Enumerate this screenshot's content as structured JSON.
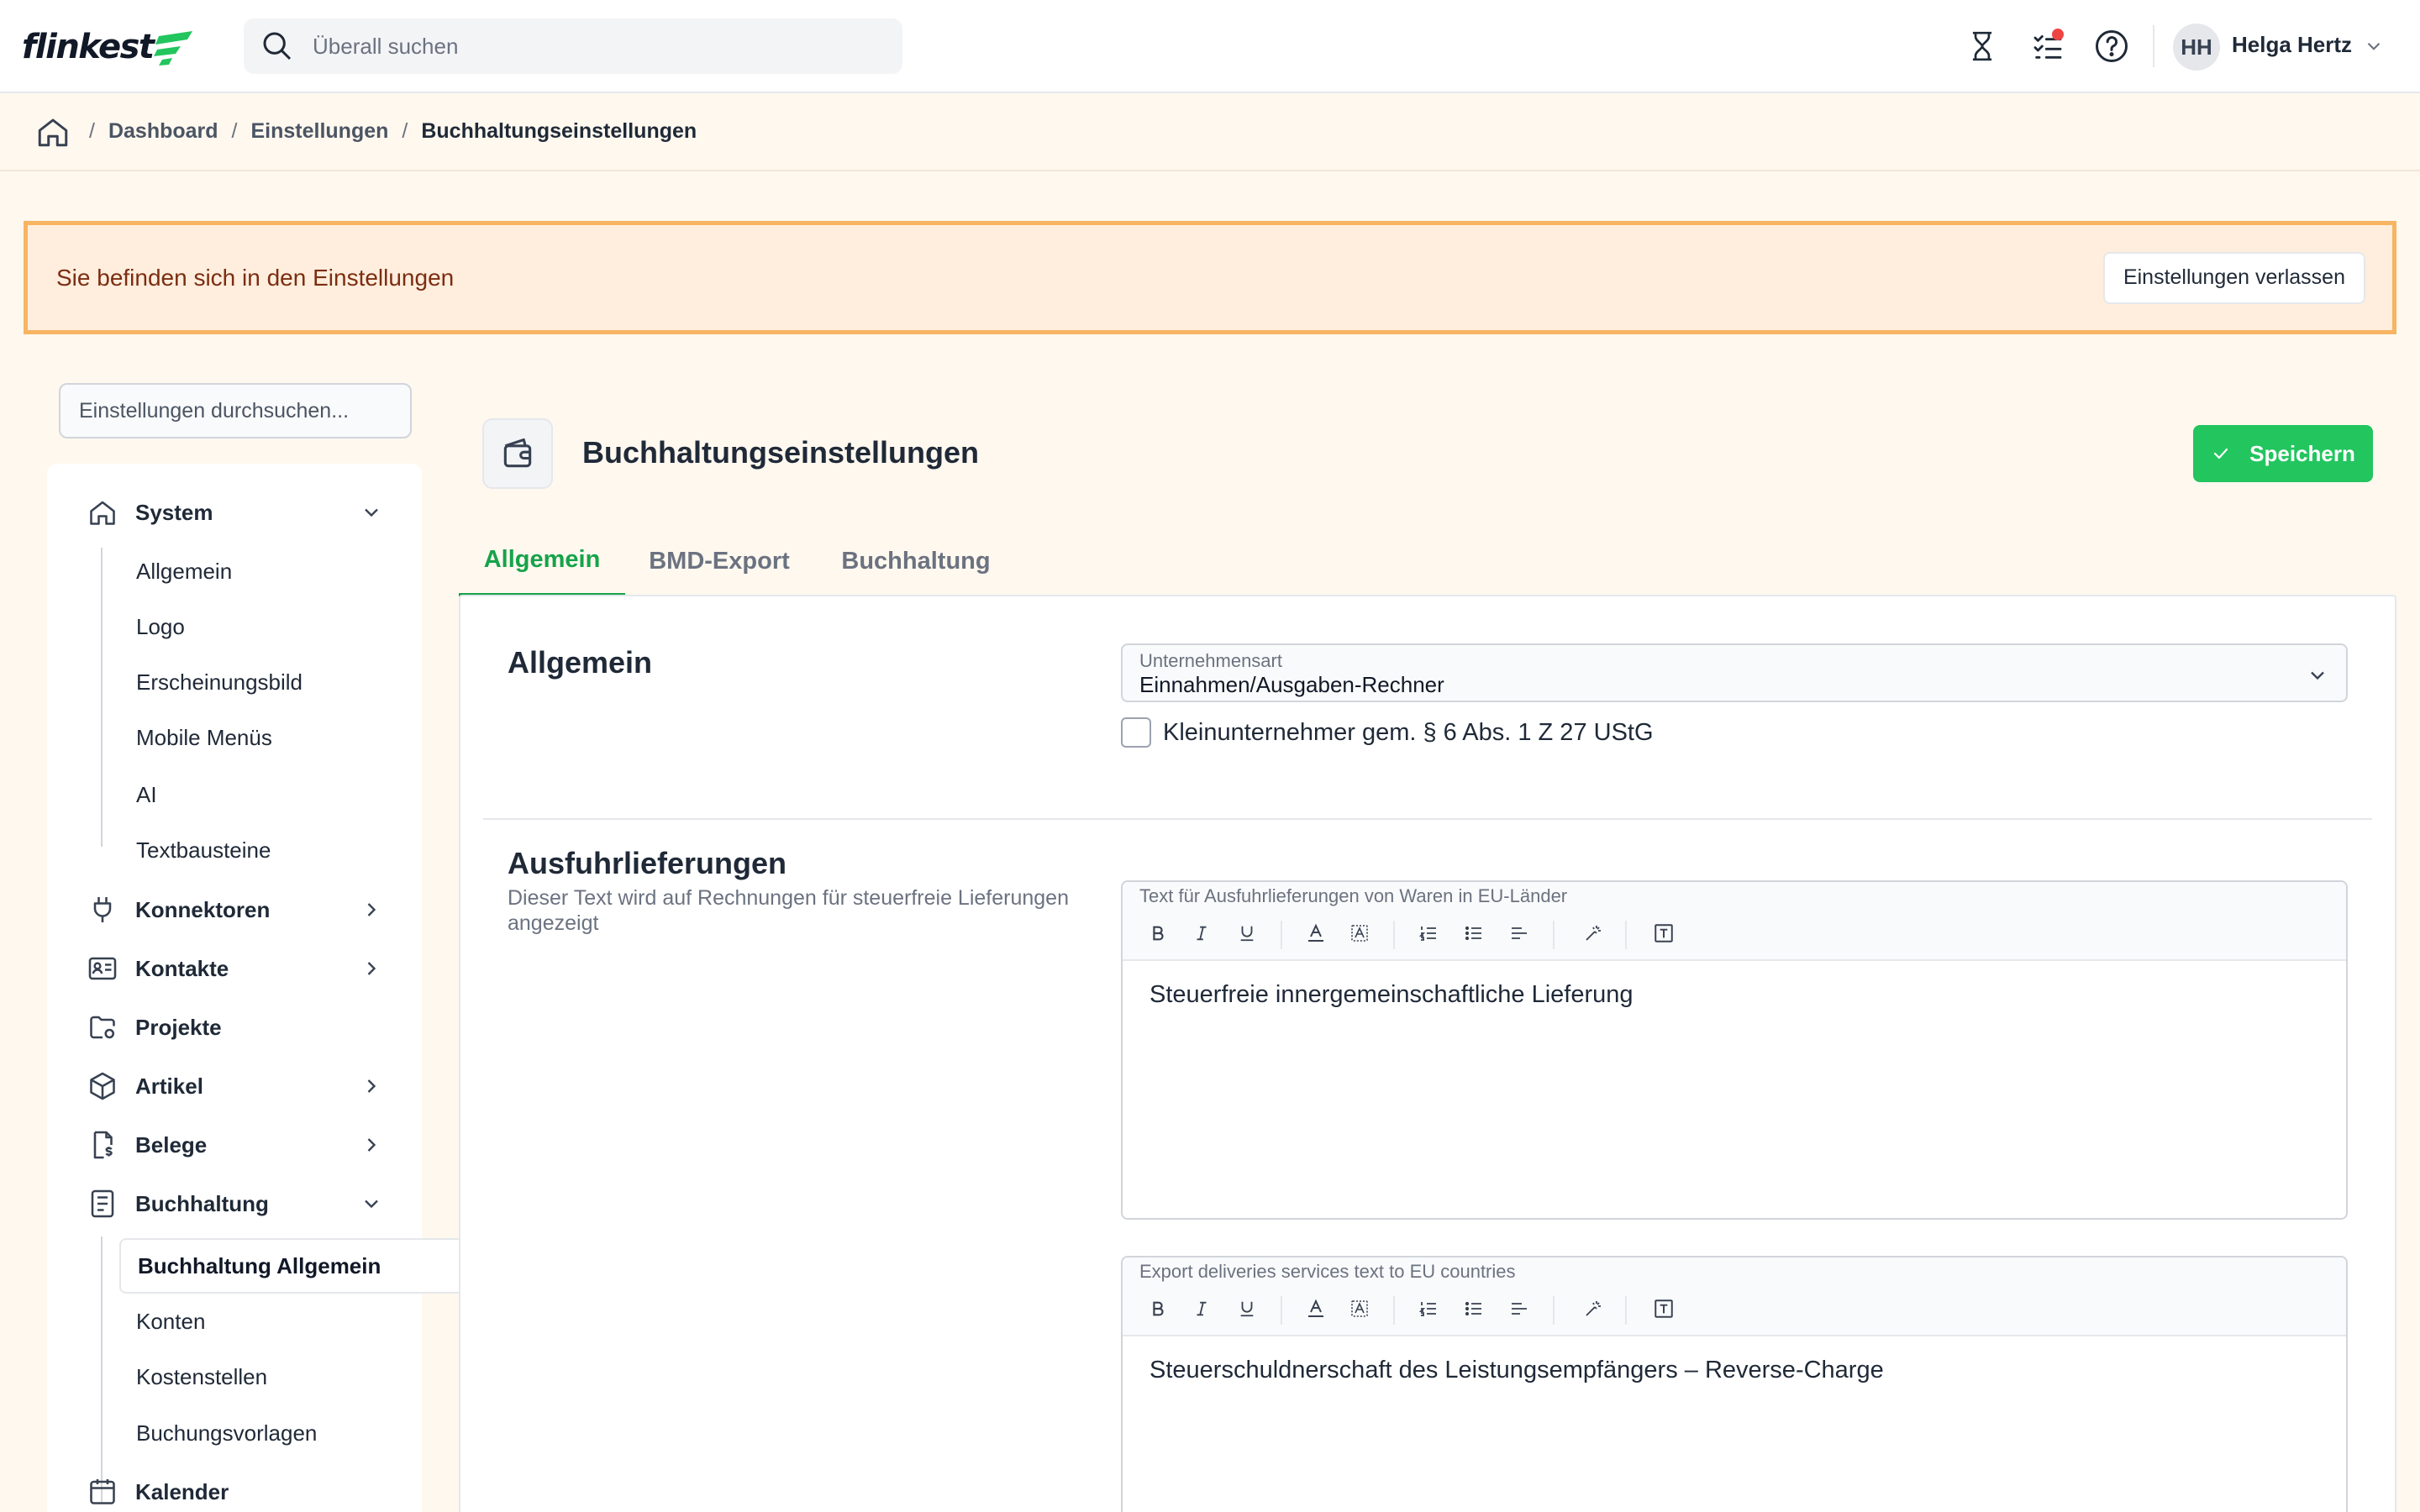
{
  "app": {
    "logo_text": "flinkest"
  },
  "header": {
    "search_placeholder": "Überall suchen",
    "user": {
      "initials": "HH",
      "name": "Helga Hertz"
    }
  },
  "breadcrumb": {
    "items": [
      "Dashboard",
      "Einstellungen",
      "Buchhaltungseinstellungen"
    ]
  },
  "banner": {
    "text": "Sie befinden sich in den Einstellungen",
    "button_label": "Einstellungen verlassen"
  },
  "sidebar": {
    "search_placeholder": "Einstellungen durchsuchen...",
    "system": {
      "label": "System",
      "children": [
        "Allgemein",
        "Logo",
        "Erscheinungsbild",
        "Mobile Menüs",
        "AI",
        "Textbausteine"
      ]
    },
    "konnektoren": "Konnektoren",
    "kontakte": "Kontakte",
    "projekte": "Projekte",
    "artikel": "Artikel",
    "belege": "Belege",
    "buchhaltung": {
      "label": "Buchhaltung",
      "active_child": "Buchhaltung Allgemein",
      "children": [
        "Konten",
        "Kostenstellen",
        "Buchungsvorlagen"
      ]
    },
    "kalender": "Kalender"
  },
  "main": {
    "title": "Buchhaltungseinstellungen",
    "save_label": "Speichern",
    "tabs": [
      "Allgemein",
      "BMD-Export",
      "Buchhaltung"
    ],
    "active_tab": "Allgemein",
    "section_general": {
      "title": "Allgemein",
      "company_type_label": "Unternehmensart",
      "company_type_value": "Einnahmen/Ausgaben-Rechner",
      "small_business_label": "Kleinunternehmer gem. § 6 Abs. 1 Z 27 UStG",
      "small_business_checked": false
    },
    "section_export": {
      "title": "Ausfuhrlieferungen",
      "description": "Dieser Text wird auf Rechnungen für steuerfreie Lieferungen angezeigt",
      "editor1_label": "Text für Ausfuhrlieferungen von Waren in EU-Länder",
      "editor1_content": "Steuerfreie innergemeinschaftliche Lieferung",
      "editor2_label": "Export deliveries services text to EU countries",
      "editor2_content": "Steuerschuldnerschaft des Leistungsempfängers – Reverse-Charge"
    }
  },
  "colors": {
    "accent": "#22c55e",
    "banner_bg": "#ffeedd",
    "banner_border": "#f7b462",
    "notification": "#ef4444"
  }
}
